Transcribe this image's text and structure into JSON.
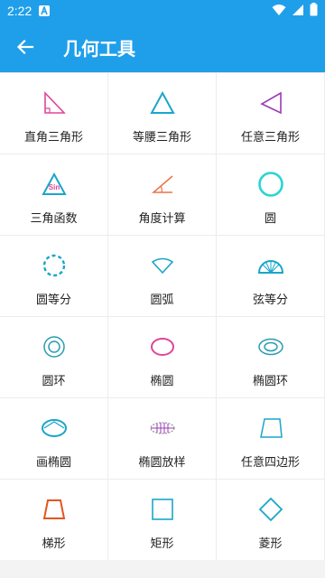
{
  "status_bar": {
    "time": "2:22",
    "notification_icon": "a-badge-icon",
    "icons": [
      "wifi-icon",
      "signal-icon",
      "battery-icon"
    ]
  },
  "app_bar": {
    "back_icon": "arrow-left-icon",
    "title": "几何工具"
  },
  "colors": {
    "primary": "#1f9fea",
    "pink": "#e0459a",
    "teal": "#1aa6c9",
    "purple": "#9b3ab8",
    "orange": "#e9744a",
    "cyan": "#2ad4d4",
    "gray": "#9a9a9a"
  },
  "tools": [
    {
      "label": "直角三角形",
      "icon": "right-triangle-icon"
    },
    {
      "label": "等腰三角形",
      "icon": "isosceles-triangle-icon"
    },
    {
      "label": "任意三角形",
      "icon": "any-triangle-icon"
    },
    {
      "label": "三角函数",
      "icon": "trig-function-icon",
      "icon_text": "Sin"
    },
    {
      "label": "角度计算",
      "icon": "angle-icon"
    },
    {
      "label": "圆",
      "icon": "circle-icon"
    },
    {
      "label": "圆等分",
      "icon": "circle-division-icon"
    },
    {
      "label": "圆弧",
      "icon": "arc-icon"
    },
    {
      "label": "弦等分",
      "icon": "chord-division-icon"
    },
    {
      "label": "圆环",
      "icon": "ring-icon"
    },
    {
      "label": "椭圆",
      "icon": "ellipse-icon"
    },
    {
      "label": "椭圆环",
      "icon": "ellipse-ring-icon"
    },
    {
      "label": "画椭圆",
      "icon": "draw-ellipse-icon"
    },
    {
      "label": "椭圆放样",
      "icon": "ellipse-lofting-icon"
    },
    {
      "label": "任意四边形",
      "icon": "any-quadrilateral-icon"
    },
    {
      "label": "梯形",
      "icon": "trapezoid-icon"
    },
    {
      "label": "矩形",
      "icon": "rectangle-icon"
    },
    {
      "label": "菱形",
      "icon": "rhombus-icon"
    }
  ]
}
